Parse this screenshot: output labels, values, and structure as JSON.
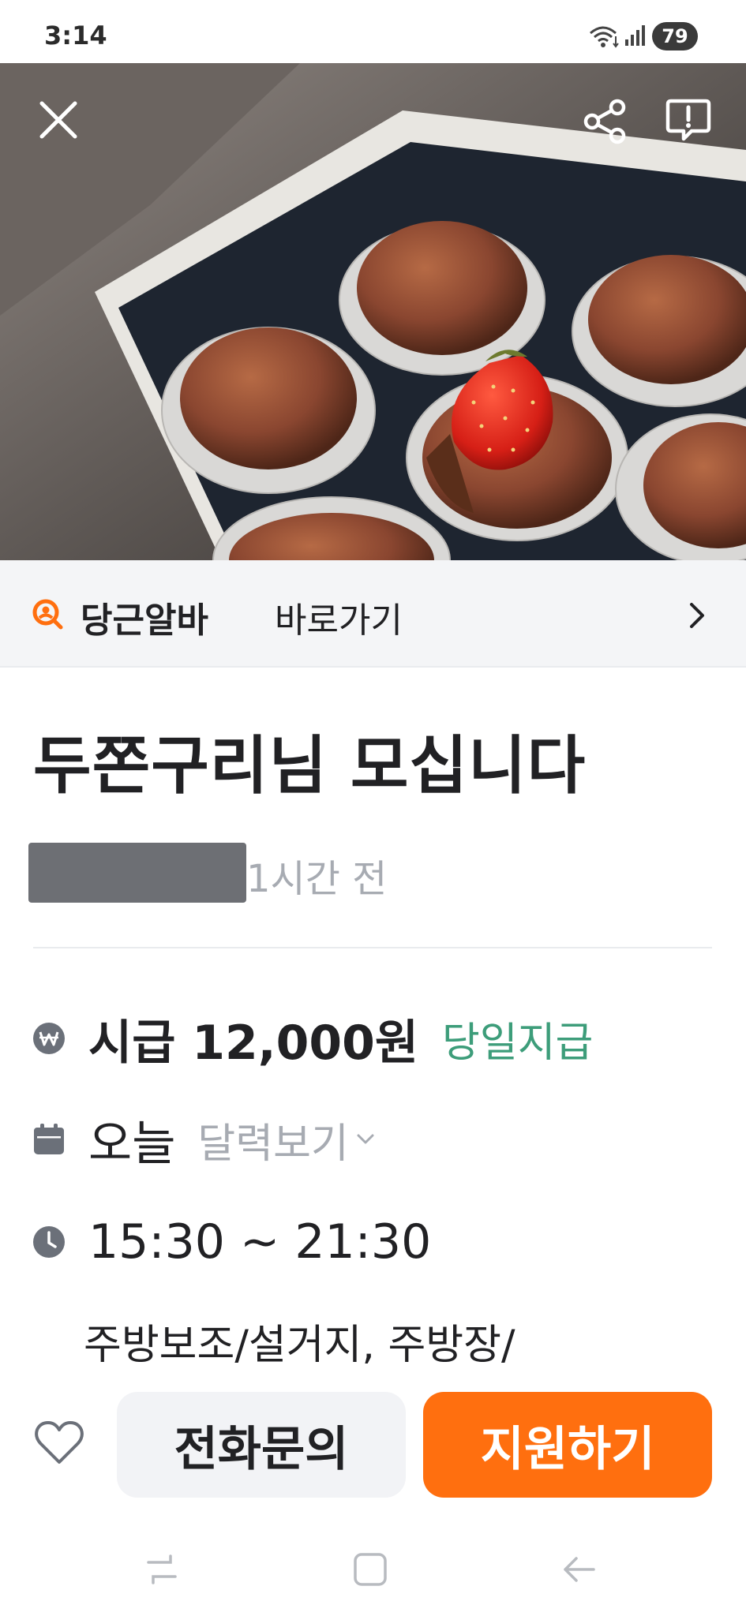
{
  "status_bar": {
    "time": "3:14",
    "battery": "79"
  },
  "hero": {
    "icons": [
      "close-icon",
      "share-icon",
      "report-icon"
    ]
  },
  "alba_banner": {
    "brand": "당근알바",
    "link_text": "바로가기",
    "icons": [
      "search-person-icon",
      "chevron-right-icon"
    ]
  },
  "post": {
    "title": "두쫀구리님 모십니다",
    "posted_ago": "1시간 전"
  },
  "details": {
    "wage": "시급 12,000원",
    "wage_badge": "당일지급",
    "date": "오늘",
    "calendar_link": "달력보기",
    "time": "15:30 ~ 21:30",
    "job_category": "주방보조/설거지, 주방장/"
  },
  "actions": {
    "call_label": "전화문의",
    "apply_label": "지원하기"
  },
  "colors": {
    "accent": "#ff6f0f",
    "badge_green": "#3d9d7a",
    "secondary_text": "#a7abb2",
    "banner_bg": "#f4f5f7"
  }
}
